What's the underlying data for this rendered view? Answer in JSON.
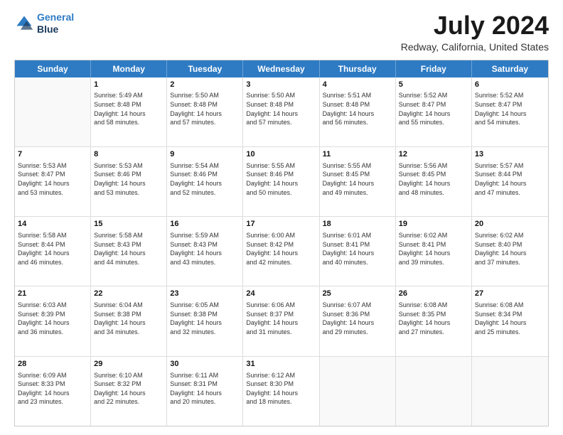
{
  "header": {
    "logo_line1": "General",
    "logo_line2": "Blue",
    "title": "July 2024",
    "subtitle": "Redway, California, United States"
  },
  "days_of_week": [
    "Sunday",
    "Monday",
    "Tuesday",
    "Wednesday",
    "Thursday",
    "Friday",
    "Saturday"
  ],
  "weeks": [
    [
      {
        "day": "",
        "info": ""
      },
      {
        "day": "1",
        "info": "Sunrise: 5:49 AM\nSunset: 8:48 PM\nDaylight: 14 hours\nand 58 minutes."
      },
      {
        "day": "2",
        "info": "Sunrise: 5:50 AM\nSunset: 8:48 PM\nDaylight: 14 hours\nand 57 minutes."
      },
      {
        "day": "3",
        "info": "Sunrise: 5:50 AM\nSunset: 8:48 PM\nDaylight: 14 hours\nand 57 minutes."
      },
      {
        "day": "4",
        "info": "Sunrise: 5:51 AM\nSunset: 8:48 PM\nDaylight: 14 hours\nand 56 minutes."
      },
      {
        "day": "5",
        "info": "Sunrise: 5:52 AM\nSunset: 8:47 PM\nDaylight: 14 hours\nand 55 minutes."
      },
      {
        "day": "6",
        "info": "Sunrise: 5:52 AM\nSunset: 8:47 PM\nDaylight: 14 hours\nand 54 minutes."
      }
    ],
    [
      {
        "day": "7",
        "info": "Sunrise: 5:53 AM\nSunset: 8:47 PM\nDaylight: 14 hours\nand 53 minutes."
      },
      {
        "day": "8",
        "info": "Sunrise: 5:53 AM\nSunset: 8:46 PM\nDaylight: 14 hours\nand 53 minutes."
      },
      {
        "day": "9",
        "info": "Sunrise: 5:54 AM\nSunset: 8:46 PM\nDaylight: 14 hours\nand 52 minutes."
      },
      {
        "day": "10",
        "info": "Sunrise: 5:55 AM\nSunset: 8:46 PM\nDaylight: 14 hours\nand 50 minutes."
      },
      {
        "day": "11",
        "info": "Sunrise: 5:55 AM\nSunset: 8:45 PM\nDaylight: 14 hours\nand 49 minutes."
      },
      {
        "day": "12",
        "info": "Sunrise: 5:56 AM\nSunset: 8:45 PM\nDaylight: 14 hours\nand 48 minutes."
      },
      {
        "day": "13",
        "info": "Sunrise: 5:57 AM\nSunset: 8:44 PM\nDaylight: 14 hours\nand 47 minutes."
      }
    ],
    [
      {
        "day": "14",
        "info": "Sunrise: 5:58 AM\nSunset: 8:44 PM\nDaylight: 14 hours\nand 46 minutes."
      },
      {
        "day": "15",
        "info": "Sunrise: 5:58 AM\nSunset: 8:43 PM\nDaylight: 14 hours\nand 44 minutes."
      },
      {
        "day": "16",
        "info": "Sunrise: 5:59 AM\nSunset: 8:43 PM\nDaylight: 14 hours\nand 43 minutes."
      },
      {
        "day": "17",
        "info": "Sunrise: 6:00 AM\nSunset: 8:42 PM\nDaylight: 14 hours\nand 42 minutes."
      },
      {
        "day": "18",
        "info": "Sunrise: 6:01 AM\nSunset: 8:41 PM\nDaylight: 14 hours\nand 40 minutes."
      },
      {
        "day": "19",
        "info": "Sunrise: 6:02 AM\nSunset: 8:41 PM\nDaylight: 14 hours\nand 39 minutes."
      },
      {
        "day": "20",
        "info": "Sunrise: 6:02 AM\nSunset: 8:40 PM\nDaylight: 14 hours\nand 37 minutes."
      }
    ],
    [
      {
        "day": "21",
        "info": "Sunrise: 6:03 AM\nSunset: 8:39 PM\nDaylight: 14 hours\nand 36 minutes."
      },
      {
        "day": "22",
        "info": "Sunrise: 6:04 AM\nSunset: 8:38 PM\nDaylight: 14 hours\nand 34 minutes."
      },
      {
        "day": "23",
        "info": "Sunrise: 6:05 AM\nSunset: 8:38 PM\nDaylight: 14 hours\nand 32 minutes."
      },
      {
        "day": "24",
        "info": "Sunrise: 6:06 AM\nSunset: 8:37 PM\nDaylight: 14 hours\nand 31 minutes."
      },
      {
        "day": "25",
        "info": "Sunrise: 6:07 AM\nSunset: 8:36 PM\nDaylight: 14 hours\nand 29 minutes."
      },
      {
        "day": "26",
        "info": "Sunrise: 6:08 AM\nSunset: 8:35 PM\nDaylight: 14 hours\nand 27 minutes."
      },
      {
        "day": "27",
        "info": "Sunrise: 6:08 AM\nSunset: 8:34 PM\nDaylight: 14 hours\nand 25 minutes."
      }
    ],
    [
      {
        "day": "28",
        "info": "Sunrise: 6:09 AM\nSunset: 8:33 PM\nDaylight: 14 hours\nand 23 minutes."
      },
      {
        "day": "29",
        "info": "Sunrise: 6:10 AM\nSunset: 8:32 PM\nDaylight: 14 hours\nand 22 minutes."
      },
      {
        "day": "30",
        "info": "Sunrise: 6:11 AM\nSunset: 8:31 PM\nDaylight: 14 hours\nand 20 minutes."
      },
      {
        "day": "31",
        "info": "Sunrise: 6:12 AM\nSunset: 8:30 PM\nDaylight: 14 hours\nand 18 minutes."
      },
      {
        "day": "",
        "info": ""
      },
      {
        "day": "",
        "info": ""
      },
      {
        "day": "",
        "info": ""
      }
    ]
  ]
}
